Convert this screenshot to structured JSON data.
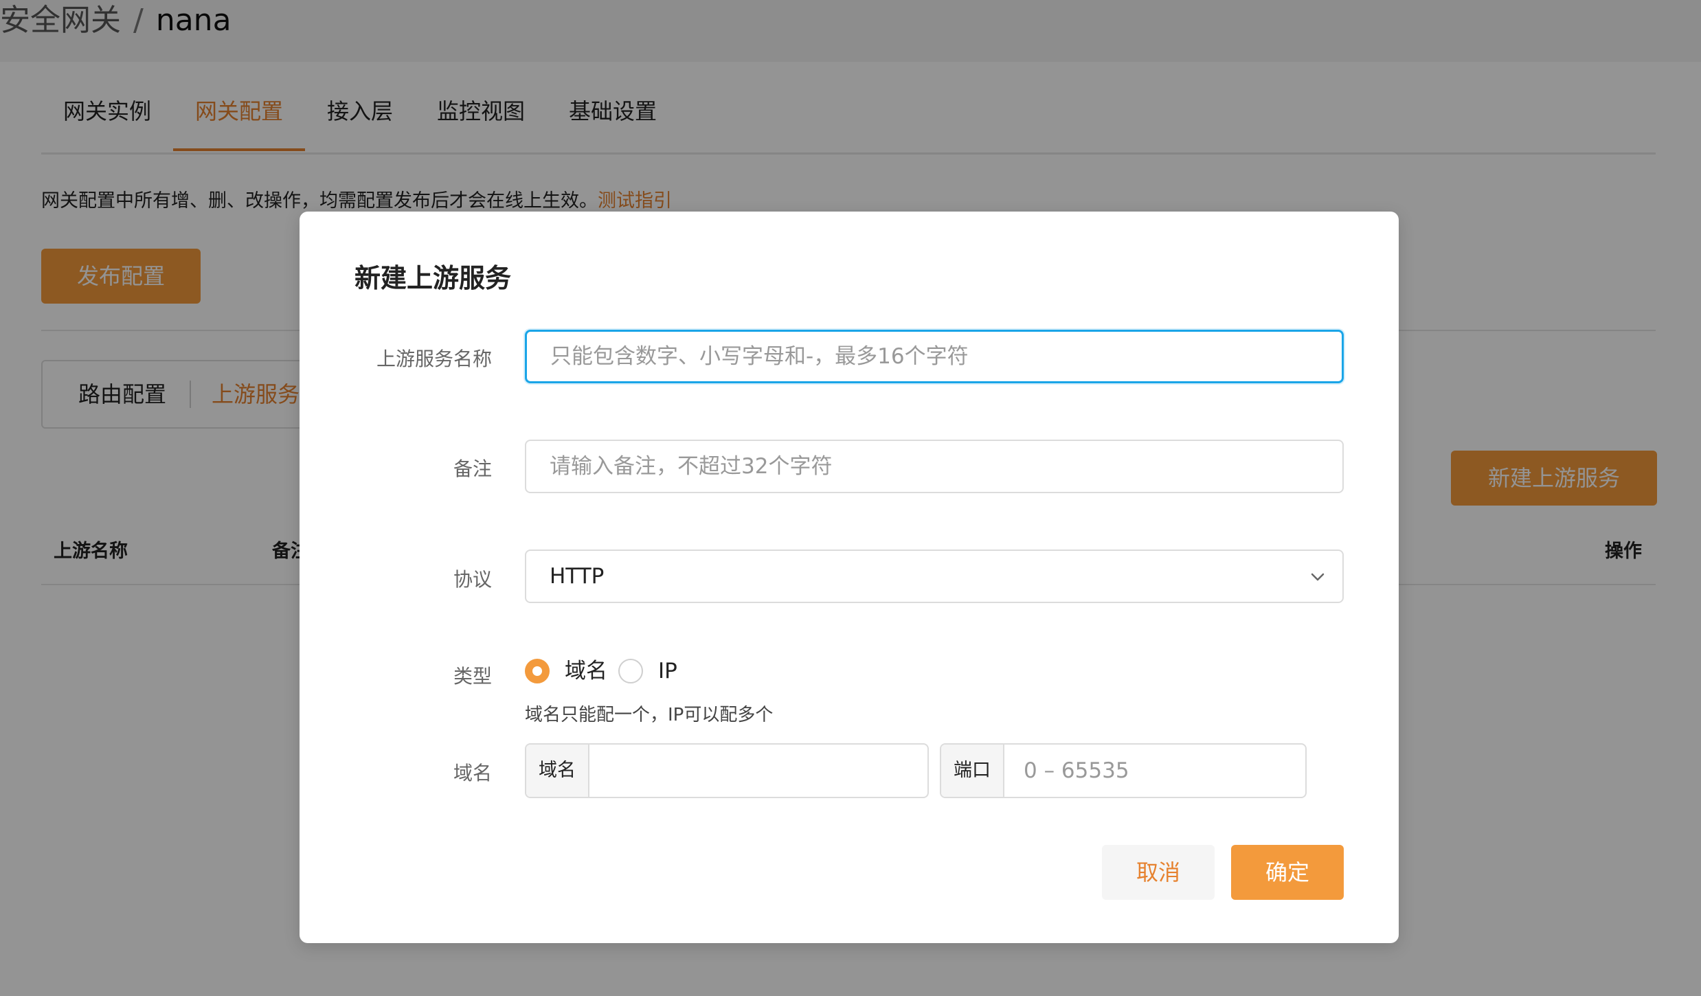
{
  "breadcrumb": {
    "parent": "安全网关",
    "separator": "/",
    "current": "nana"
  },
  "tabs": [
    {
      "label": "网关实例",
      "active": false
    },
    {
      "label": "网关配置",
      "active": true
    },
    {
      "label": "接入层",
      "active": false
    },
    {
      "label": "监控视图",
      "active": false
    },
    {
      "label": "基础设置",
      "active": false
    }
  ],
  "notice": {
    "text": "网关配置中所有增、删、改操作，均需配置发布后才会在线上生效。",
    "link": "测试指引"
  },
  "toolbar": {
    "publish_label": "发布配置",
    "new_upstream_label": "新建上游服务"
  },
  "subtabs": [
    {
      "label": "路由配置",
      "active": false
    },
    {
      "label": "上游服务",
      "active": true
    }
  ],
  "table": {
    "columns": [
      "上游名称",
      "备注",
      "操作"
    ]
  },
  "modal": {
    "title": "新建上游服务",
    "fields": {
      "name": {
        "label": "上游服务名称",
        "placeholder": "只能包含数字、小写字母和-，最多16个字符"
      },
      "remark": {
        "label": "备注",
        "placeholder": "请输入备注，不超过32个字符"
      },
      "protocol": {
        "label": "协议",
        "value": "HTTP"
      },
      "type": {
        "label": "类型",
        "options": [
          {
            "label": "域名",
            "checked": true
          },
          {
            "label": "IP",
            "checked": false
          }
        ],
        "hint": "域名只能配一个，IP可以配多个"
      },
      "domain": {
        "label": "域名",
        "domain_addon": "域名",
        "domain_value": "",
        "port_addon": "端口",
        "port_placeholder": "0 – 65535"
      }
    },
    "cancel_label": "取消",
    "ok_label": "确定"
  },
  "colors": {
    "accent": "#f39a3c",
    "accent_text": "#e6822f",
    "focus": "#1aa5e8"
  }
}
